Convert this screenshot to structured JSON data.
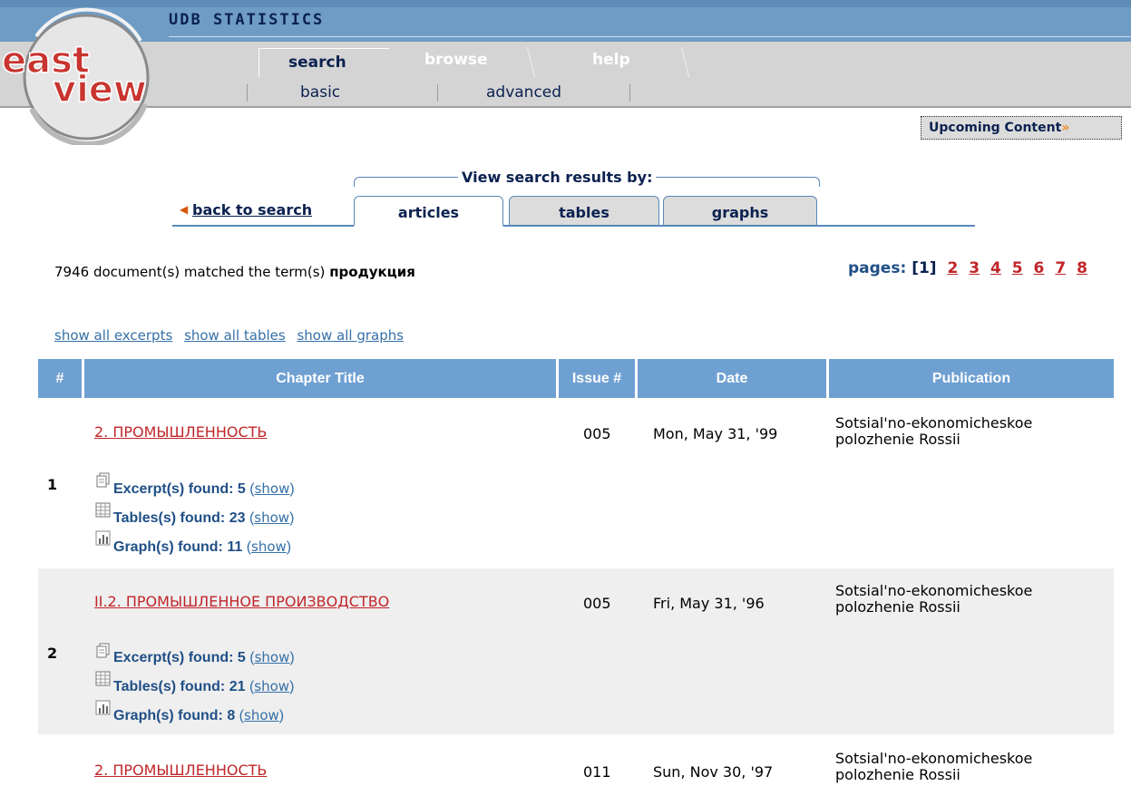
{
  "header": {
    "app_title": "UDB STATISTICS",
    "logo_text_top": "east",
    "logo_text_bottom": "view",
    "tabs": [
      {
        "label": "search",
        "active": true
      },
      {
        "label": "browse",
        "active": false
      },
      {
        "label": "help",
        "active": false
      }
    ],
    "subtabs": [
      {
        "label": "basic"
      },
      {
        "label": "advanced"
      }
    ],
    "upcoming_label": "Upcoming Content",
    "upcoming_arrows": "»"
  },
  "view_results": {
    "label": "View search results by:",
    "back_label": "back to search",
    "tabs": [
      {
        "label": "articles",
        "active": true
      },
      {
        "label": "tables",
        "active": false
      },
      {
        "label": "graphs",
        "active": false
      }
    ]
  },
  "summary": {
    "matched_text": "7946 document(s) matched the term(s)",
    "term": "продукция",
    "pages_label": "pages:",
    "current_page": "[1]",
    "pages": [
      "2",
      "3",
      "4",
      "5",
      "6",
      "7",
      "8"
    ]
  },
  "show_links": [
    "show all excerpts",
    "show all tables",
    "show all graphs"
  ],
  "table": {
    "columns": [
      "#",
      "Chapter Title",
      "Issue #",
      "Date",
      "Publication"
    ],
    "rows": [
      {
        "num": "1",
        "chapter_title": "2. ПРОМЫШЛЕННОСТЬ",
        "issue": "005",
        "date": "Mon, May 31, '99",
        "publication_line1": "Sotsial'no-ekonomicheskoe",
        "publication_line2": "polozhenie Rossii",
        "excerpts": "Excerpt(s) found: 5",
        "tables": "Tables(s) found: 23",
        "graphs": "Graph(s) found: 11",
        "show_label": "show"
      },
      {
        "num": "2",
        "chapter_title": "II.2. ПРОМЫШЛЕННОЕ ПРОИЗВОДСТВО",
        "issue": "005",
        "date": "Fri, May 31, '96",
        "publication_line1": "Sotsial'no-ekonomicheskoe",
        "publication_line2": "polozhenie Rossii",
        "excerpts": "Excerpt(s) found: 5",
        "tables": "Tables(s) found: 21",
        "graphs": "Graph(s) found: 8",
        "show_label": "show"
      },
      {
        "chapter_title": "2. ПРОМЫШЛЕННОСТЬ",
        "issue": "011",
        "date": "Sun, Nov 30, '97",
        "publication_line1": "Sotsial'no-ekonomicheskoe",
        "publication_line2": "polozhenie Rossii"
      }
    ]
  },
  "colors": {
    "header_blue": "#6f9cc5",
    "table_header": "#6fa0d2",
    "link_red": "#c0262a",
    "row_alt": "#efefef"
  }
}
